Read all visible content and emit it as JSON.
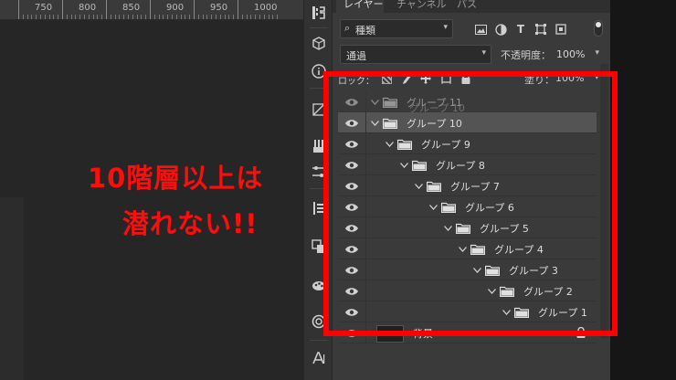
{
  "ruler": {
    "labels": [
      "750",
      "800",
      "850",
      "900",
      "950",
      "1000"
    ]
  },
  "panel": {
    "tabs": [
      "レイヤー",
      "チャンネル",
      "パス"
    ],
    "filter": {
      "kind_label": "種類"
    },
    "blend": {
      "mode": "通過",
      "opacity_label": "不透明度：",
      "opacity_value": "100%"
    },
    "lock": {
      "label": "ロック：",
      "fill_label": "塗り：",
      "fill_value": "100%"
    },
    "layers": [
      {
        "name": "グループ 11",
        "ghost_name": "グループ 10",
        "dragging": true
      },
      {
        "name": "グループ 10",
        "selected": true
      },
      {
        "name": "グループ 9"
      },
      {
        "name": "グループ 8"
      },
      {
        "name": "グループ 7"
      },
      {
        "name": "グループ 6"
      },
      {
        "name": "グループ 5"
      },
      {
        "name": "グループ 4"
      },
      {
        "name": "グループ 3"
      },
      {
        "name": "グループ 2"
      },
      {
        "name": "グループ 1"
      }
    ],
    "background_layer": {
      "name": "背景"
    }
  },
  "annotation": {
    "line1": "10階層以上は",
    "line2": "潜れない!!",
    "color": "#ff0000"
  },
  "icons": {
    "eye": "eye-icon",
    "folder": "folder-icon",
    "collapse": "chevron-down-icon",
    "lock": "lock-icon"
  }
}
